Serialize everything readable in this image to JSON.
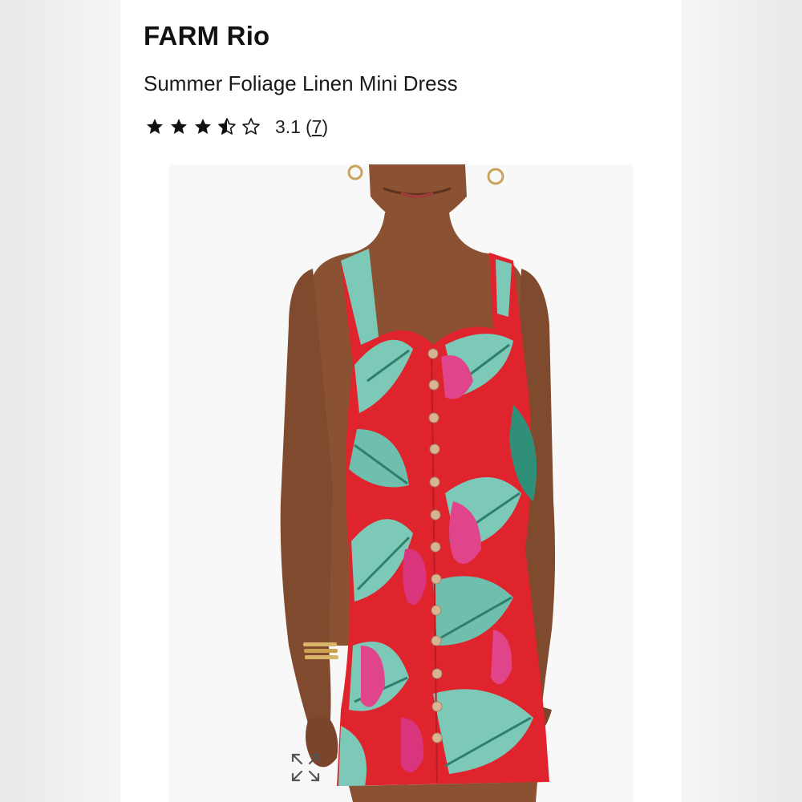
{
  "product": {
    "brand": "FARM Rio",
    "name": "Summer Foliage Linen Mini Dress",
    "rating": {
      "value": "3.1",
      "count_open": "(",
      "count": "7",
      "count_close": ")",
      "stars_filled": 3,
      "stars_half": 1,
      "stars_empty": 1,
      "max": 5
    },
    "image_alt": "Model wearing red tropical print linen mini dress"
  },
  "icons": {
    "star_full": "star-filled-icon",
    "star_half": "star-half-icon",
    "star_empty": "star-outline-icon",
    "expand": "expand-icon"
  },
  "colors": {
    "dress_red": "#e0242e",
    "leaf_teal": "#7cc9b8",
    "parrot_pink": "#e0448a",
    "skin": "#8a5233",
    "text": "#111111"
  }
}
